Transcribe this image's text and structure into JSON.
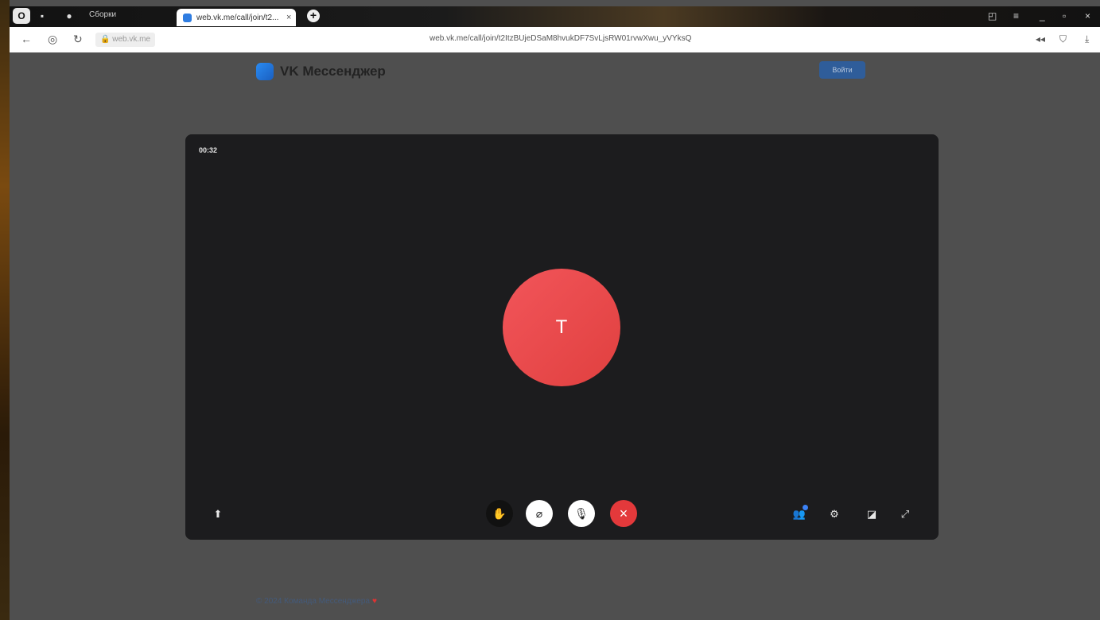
{
  "browser": {
    "active_tab_title": "web.vk.me/call/join/t2...",
    "inactive_tab_title": "Сборки",
    "url": "web.vk.me/call/join/t2ItzBUjeDSaM8hvukDF7SvLjsRW01rvwXwu_yVYksQ",
    "site_chip": "web.vk.me"
  },
  "page": {
    "brand": "VK Мессенджер",
    "login_label": "Войти"
  },
  "call": {
    "timer": "00:32",
    "avatar_initial": "T"
  },
  "footer": {
    "text": "© 2024 Команда Мессенджера"
  },
  "colors": {
    "hangup": "#e3393b",
    "avatar": "#f2555a",
    "accent": "#2f5d9a"
  }
}
